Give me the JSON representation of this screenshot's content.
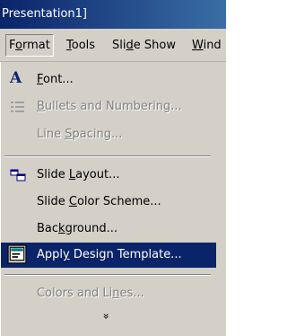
{
  "window": {
    "title": "Presentation1]"
  },
  "menubar": [
    {
      "label": "Format",
      "u": "o",
      "pre": "F",
      "post": "rmat",
      "active": true
    },
    {
      "label": "Tools",
      "pre": "",
      "u": "T",
      "post": "ools"
    },
    {
      "label": "Slide Show",
      "pre": "Sli",
      "u": "d",
      "post": "e Show"
    },
    {
      "label": "Wind",
      "pre": "",
      "u": "W",
      "post": "ind"
    }
  ],
  "menu": {
    "font": {
      "pre": "",
      "u": "F",
      "post": "ont..."
    },
    "bullets": {
      "pre": "",
      "u": "B",
      "post": "ullets and Numbering..."
    },
    "line_spacing": {
      "pre": "Line ",
      "u": "S",
      "post": "pacing..."
    },
    "slide_layout": {
      "pre": "Slide ",
      "u": "L",
      "post": "ayout..."
    },
    "slide_color_scheme": {
      "pre": "Slide ",
      "u": "C",
      "post": "olor Scheme..."
    },
    "background": {
      "pre": "Bac",
      "u": "k",
      "post": "ground..."
    },
    "apply_design": {
      "pre": "Appl",
      "u": "y",
      "post": " Design Template..."
    },
    "colors_lines": {
      "pre": "Colors and Li",
      "u": "n",
      "post": "es..."
    },
    "expand": "»"
  }
}
